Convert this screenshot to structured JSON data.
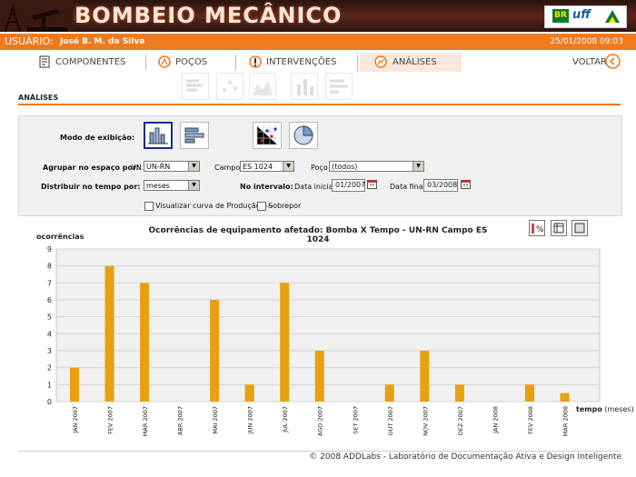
{
  "app": {
    "title": "BOMBEIO MECÂNICO",
    "logo_br": "BR",
    "logo_uff": "uff"
  },
  "user": {
    "label": "USUÁRIO:",
    "name": "José B. M. da Silva",
    "datetime": "25/01/2008 09:03"
  },
  "nav": {
    "items": [
      {
        "label": "COMPONENTES",
        "icon": "document-icon"
      },
      {
        "label": "POÇOS",
        "icon": "well-icon"
      },
      {
        "label": "INTERVENÇÕES",
        "icon": "intervention-icon"
      },
      {
        "label": "ANÁLISES",
        "icon": "analysis-icon",
        "active": true
      }
    ],
    "back_label": "VOLTAR"
  },
  "section_title": "ANÁLISES",
  "filters": {
    "display_mode_label": "Modo de exibição:",
    "group_label": "Agrupar no espaço por:",
    "un_label": "UN",
    "un_value": "UN-RN",
    "campo_label": "Campo",
    "campo_value": "ES 1024",
    "poco_label": "Poço",
    "poco_value": "(todos)",
    "distribute_label": "Distribuir no tempo por:",
    "distribute_value": "meses",
    "interval_label": "No intervalo:",
    "start_label": "Data inicial",
    "start_value": "01/2007",
    "end_label": "Data final",
    "end_value": "03/2008",
    "production_curve_label": "Visualizar curva de Produção ----",
    "overlay_label": "Sobrepor"
  },
  "colors": {
    "accent": "#f07a1e",
    "bar": "#e8a010",
    "chart_bg": "#f0f0f0"
  },
  "chart_data": {
    "type": "bar",
    "title": "Ocorrências de equipamento afetado: Bomba X Tempo - UN-RN Campo ES 1024",
    "ylabel": "ocorrências",
    "xlabel": "tempo",
    "xunit": "(meses)",
    "ylim": [
      0,
      9
    ],
    "yticks": [
      0,
      1,
      2,
      3,
      4,
      5,
      6,
      7,
      8,
      9
    ],
    "grid": true,
    "categories": [
      "JAN 2007",
      "FEV 2007",
      "MAR 2007",
      "ABR 2007",
      "MAI 2007",
      "JUN 2007",
      "JUL 2007",
      "AGO 2007",
      "SET 2007",
      "OUT 2007",
      "NOV 2007",
      "DEZ 2007",
      "JAN 2008",
      "FEV 2008",
      "MAR 2008"
    ],
    "values": [
      2,
      8,
      7,
      0,
      6,
      1,
      7,
      3,
      0,
      1,
      3,
      1,
      0,
      1,
      0.5
    ]
  },
  "footer": "© 2008 ADDLabs - Laboratório de Documentação Ativa e Design Inteligente"
}
